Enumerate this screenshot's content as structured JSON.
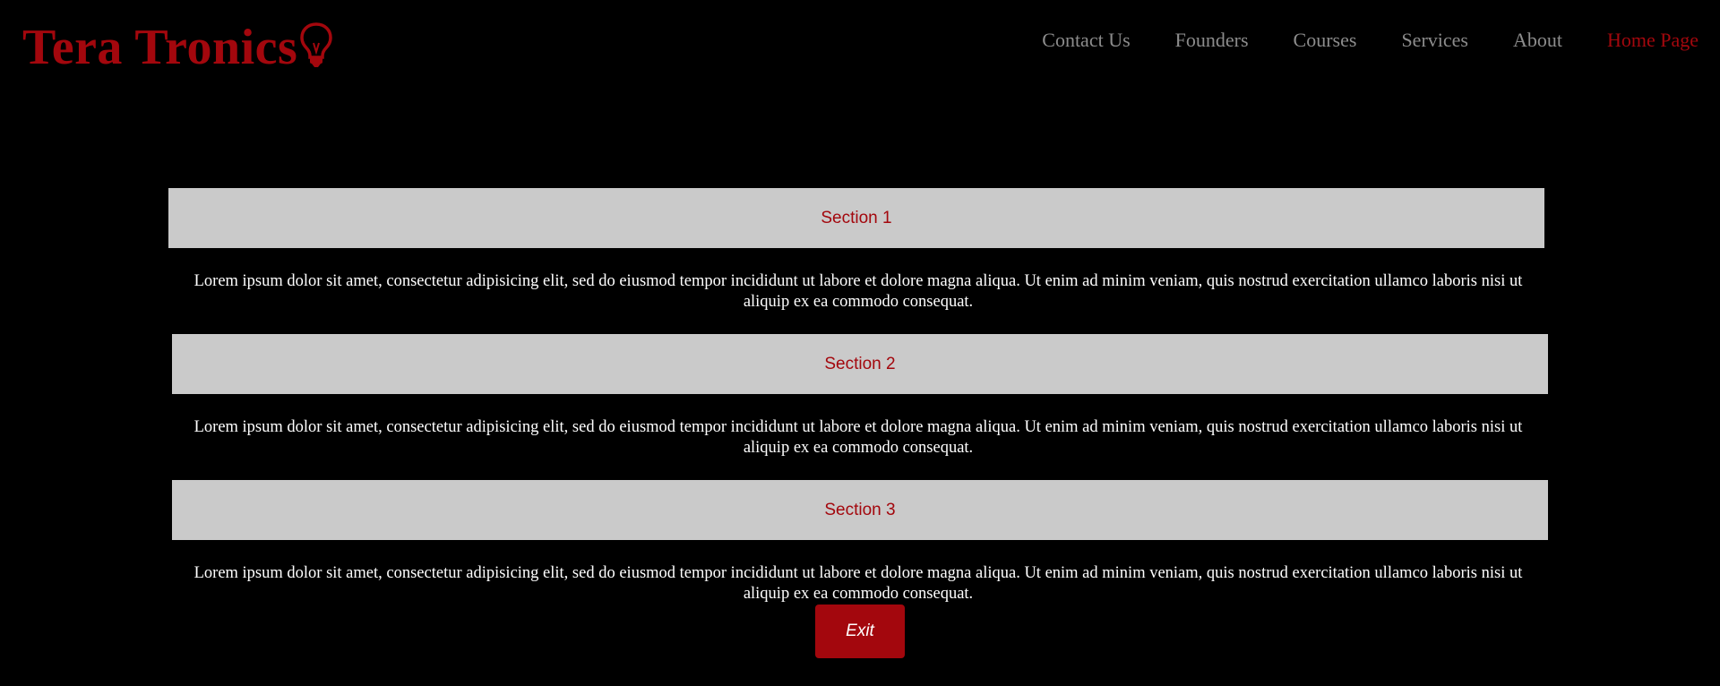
{
  "brand": {
    "name": "Tera Tronics",
    "icon": "lightbulb-icon",
    "color": "#a3070d"
  },
  "nav": {
    "items": [
      {
        "label": "Contact Us"
      },
      {
        "label": "Founders"
      },
      {
        "label": "Courses"
      },
      {
        "label": "Services"
      },
      {
        "label": "About"
      },
      {
        "label": "Home Page",
        "active": true
      }
    ]
  },
  "sections": [
    {
      "title": "Section 1",
      "body": "Lorem ipsum dolor sit amet, consectetur adipisicing elit, sed do eiusmod tempor incididunt ut labore et dolore magna aliqua. Ut enim ad minim veniam, quis nostrud exercitation ullamco laboris nisi ut aliquip ex ea commodo consequat."
    },
    {
      "title": "Section 2",
      "body": "Lorem ipsum dolor sit amet, consectetur adipisicing elit, sed do eiusmod tempor incididunt ut labore et dolore magna aliqua. Ut enim ad minim veniam, quis nostrud exercitation ullamco laboris nisi ut aliquip ex ea commodo consequat."
    },
    {
      "title": "Section 3",
      "body": "Lorem ipsum dolor sit amet, consectetur adipisicing elit, sed do eiusmod tempor incididunt ut labore et dolore magna aliqua. Ut enim ad minim veniam, quis nostrud exercitation ullamco laboris nisi ut aliquip ex ea commodo consequat."
    }
  ],
  "exit_button": {
    "label": "Exit"
  },
  "colors": {
    "background": "#000000",
    "accent": "#a3070d",
    "nav_text": "#8c8c8c",
    "section_header_bg": "#cacaca",
    "body_text": "#ffffff"
  }
}
